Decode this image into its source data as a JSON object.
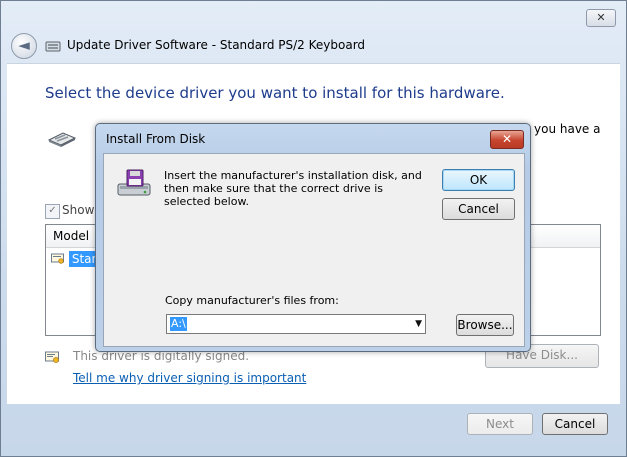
{
  "wizard": {
    "title": "Update Driver Software - Standard PS/2 Keyboard",
    "close_glyph": "✕",
    "back_glyph": "◄",
    "heading": "Select the device driver you want to install for this hardware.",
    "description_visible": "you have a",
    "show_compatible_label": "Show",
    "show_compatible_checked": true,
    "model_header": "Model",
    "selected_model": "Stand",
    "signed_text": "This driver is digitally signed.",
    "signing_link": "Tell me why driver signing is important",
    "have_disk_label": "Have Disk...",
    "next_label": "Next",
    "cancel_label": "Cancel"
  },
  "dialog": {
    "title": "Install From Disk",
    "close_glyph": "✕",
    "instructions": "Insert the manufacturer's installation disk, and then make sure that the correct drive is selected below.",
    "ok_label": "OK",
    "cancel_label": "Cancel",
    "copy_label": "Copy manufacturer's files from:",
    "copy_value": "A:\\",
    "dropdown_glyph": "▼",
    "browse_label": "Browse..."
  },
  "colors": {
    "heading": "#1e3c8c",
    "link": "#0b5fb3",
    "selection": "#3399ff",
    "dialog_close": "#c7452e"
  },
  "icons": [
    "back-arrow-icon",
    "keyboard-icon",
    "certificate-icon",
    "floppy-disk-icon",
    "close-icon",
    "chevron-down-icon"
  ]
}
